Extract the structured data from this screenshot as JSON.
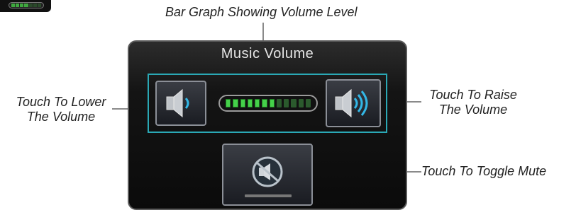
{
  "annotations": {
    "bar_graph": "Bar Graph Showing Volume Level",
    "lower_line1": "Touch To Lower",
    "lower_line2": "The Volume",
    "raise_line1": "Touch To Raise",
    "raise_line2": "The Volume",
    "mute": "Touch To Toggle Mute"
  },
  "dialog": {
    "title": "Music Volume"
  },
  "volume": {
    "segments_total": 12,
    "segments_lit": 7
  },
  "colors": {
    "frame_accent": "#2aa8b5",
    "level_on": "#45d14a",
    "level_off": "#2b5a2d",
    "speaker_wave": "#33b7e6"
  },
  "icons": {
    "lower": "speaker-low-icon",
    "raise": "speaker-high-icon",
    "mute": "mute-icon"
  }
}
